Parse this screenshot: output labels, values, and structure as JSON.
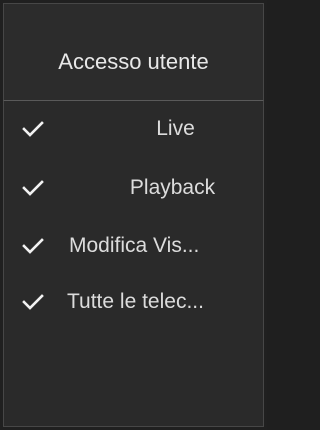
{
  "column": {
    "header": "Accesso utente"
  },
  "permissions": [
    {
      "label": "Live",
      "checked": true,
      "icon": "checkmark-icon"
    },
    {
      "label": "Playback",
      "checked": true,
      "icon": "checkmark-icon"
    },
    {
      "label": "Modifica Vis...",
      "checked": true,
      "icon": "checkmark-icon"
    },
    {
      "label": "Tutte le telec...",
      "checked": true,
      "icon": "checkmark-icon"
    }
  ],
  "colors": {
    "background": "#2a2a2a",
    "border": "#474747",
    "text": "#dcdcdc",
    "check": "#f2f2f2"
  }
}
